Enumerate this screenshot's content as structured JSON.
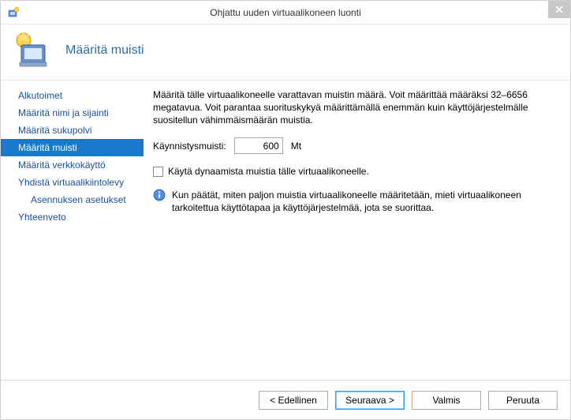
{
  "titlebar": {
    "title": "Ohjattu uuden virtuaalikoneen luonti"
  },
  "header": {
    "page_title": "Määritä muisti"
  },
  "sidebar": {
    "items": [
      {
        "label": "Alkutoimet",
        "selected": false,
        "sub": false
      },
      {
        "label": "Määritä nimi ja sijainti",
        "selected": false,
        "sub": false
      },
      {
        "label": "Määritä sukupolvi",
        "selected": false,
        "sub": false
      },
      {
        "label": "Määritä muisti",
        "selected": true,
        "sub": false
      },
      {
        "label": "Määritä verkkokäyttö",
        "selected": false,
        "sub": false
      },
      {
        "label": "Yhdistä virtuaalikiintolevy",
        "selected": false,
        "sub": false
      },
      {
        "label": "Asennuksen asetukset",
        "selected": false,
        "sub": true
      },
      {
        "label": "Yhteenveto",
        "selected": false,
        "sub": false
      }
    ]
  },
  "main": {
    "description": "Määritä tälle virtuaalikoneelle varattavan muistin määrä. Voit määrittää määräksi 32–6656 megatavua. Voit parantaa suorituskykyä määrittämällä enemmän kuin käyttöjärjestelmälle suositellun vähimmäismäärän muistia.",
    "memory_label": "Käynnistysmuisti:",
    "memory_value": "600",
    "memory_unit": "Mt",
    "dynamic_checkbox_label": "Käytä dynaamista muistia tälle virtuaalikoneelle.",
    "dynamic_checked": false,
    "info_text": "Kun päätät, miten paljon muistia virtuaalikoneelle määritetään, mieti virtuaalikoneen tarkoitettua käyttötapaa ja käyttöjärjestelmää, jota se suorittaa."
  },
  "footer": {
    "previous": "< Edellinen",
    "next": "Seuraava >",
    "finish": "Valmis",
    "cancel": "Peruuta"
  }
}
